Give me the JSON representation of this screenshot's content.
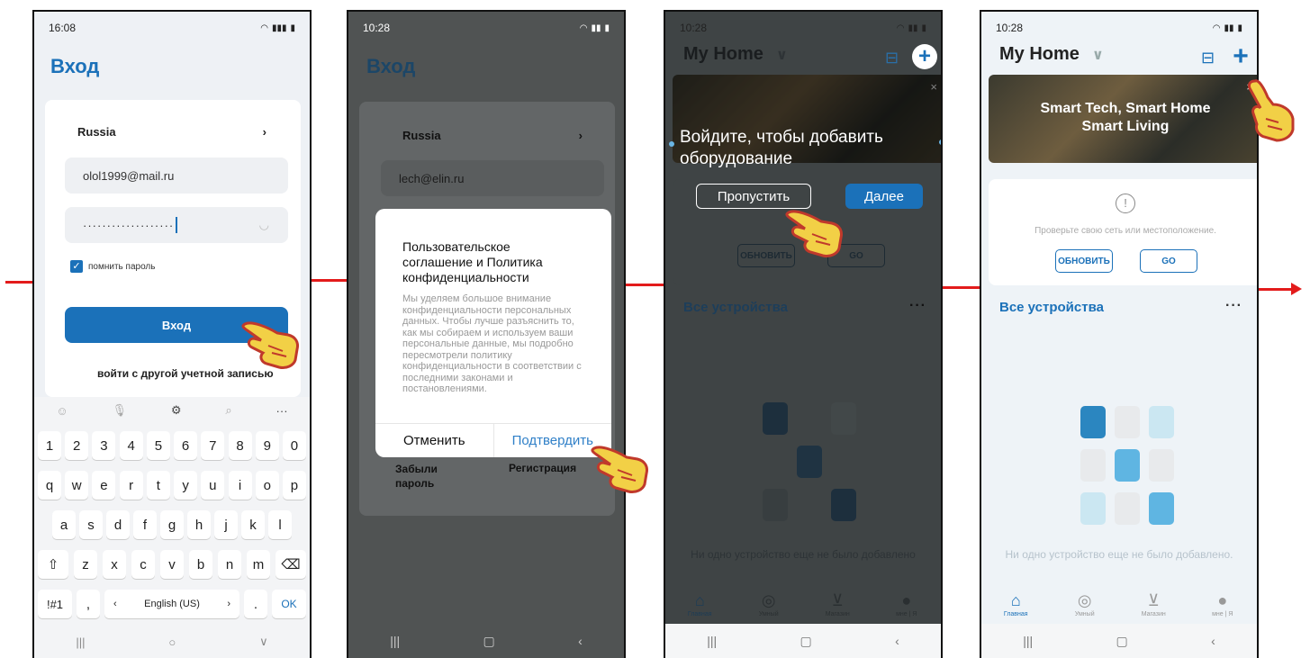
{
  "colors": {
    "accent": "#1b71b9",
    "arrow": "#e31b1b",
    "hand": "#f2d046"
  },
  "screen1": {
    "time": "16:08",
    "title": "Вход",
    "country": "Russia",
    "email": "olol1999@mail.ru",
    "password_mask": "···················",
    "remember": "помнить пароль",
    "login_button": "Вход",
    "other_account": "войти с другой учетной записью",
    "keyboard": {
      "row1": [
        "1",
        "2",
        "3",
        "4",
        "5",
        "6",
        "7",
        "8",
        "9",
        "0"
      ],
      "row2": [
        "q",
        "w",
        "e",
        "r",
        "t",
        "y",
        "u",
        "i",
        "o",
        "p"
      ],
      "row3": [
        "a",
        "s",
        "d",
        "f",
        "g",
        "h",
        "j",
        "k",
        "l"
      ],
      "row4": [
        "⇧",
        "z",
        "x",
        "c",
        "v",
        "b",
        "n",
        "m",
        "⌫"
      ],
      "sym": "!#1",
      "comma": ",",
      "lang_left": "‹",
      "lang": "English (US)",
      "lang_right": "›",
      "period": ".",
      "ok": "OK"
    }
  },
  "screen2": {
    "time": "10:28",
    "title": "Вход",
    "country": "Russia",
    "email": "lech@elin.ru",
    "forgot": "Забыли пароль",
    "register": "Регистрация",
    "dialog": {
      "title": "Пользовательское соглашение и Политика конфиденциальности",
      "body": "Мы уделяем большое внимание конфиденциальности персональных данных. Чтобы лучше разъяснить то, как мы собираем и используем ваши персональные данные, мы подробно пересмотрели политику конфиденциальности в соответствии с последними законами и постановлениями.",
      "cancel": "Отменить",
      "confirm": "Подтвердить"
    }
  },
  "screen3": {
    "time": "10:28",
    "home": "My Home",
    "overlay_text": "Войдите, чтобы добавить оборудование",
    "skip": "Пропустить",
    "next": "Далее",
    "refresh": "ОБНОВИТЬ",
    "go": "GO",
    "all_devices": "Все устройства",
    "empty": "Ни одно устройство еще не было добавлено",
    "tabs": [
      "Главная",
      "Умный",
      "Магазин",
      "мне | Я"
    ]
  },
  "screen4": {
    "time": "10:28",
    "home": "My Home",
    "banner_line1": "Smart Tech, Smart Home",
    "banner_line2": "Smart Living",
    "net_msg": "Проверьте свою сеть или местоположение.",
    "refresh": "ОБНОВИТЬ",
    "go": "GO",
    "all_devices": "Все устройства",
    "empty": "Ни одно устройство еще не было добавлено.",
    "tabs": [
      "Главная",
      "Умный",
      "Магазин",
      "мне | Я"
    ]
  }
}
